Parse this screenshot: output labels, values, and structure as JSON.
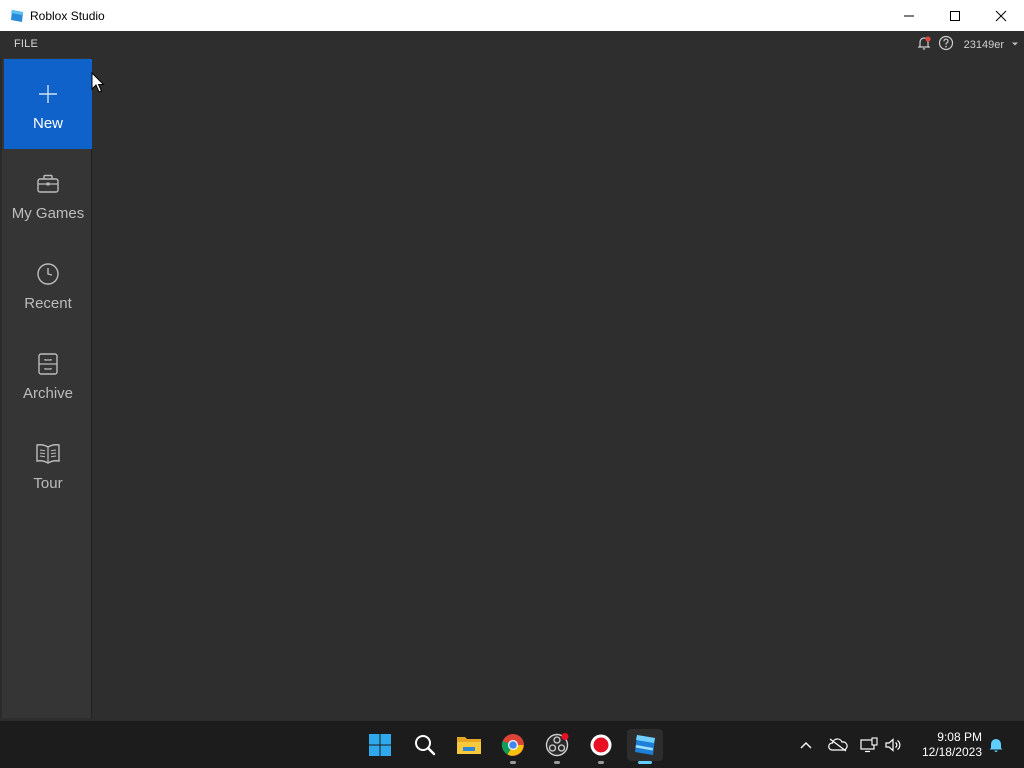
{
  "window": {
    "title": "Roblox Studio",
    "controls": [
      "minimize-icon",
      "maximize-icon",
      "close-icon"
    ]
  },
  "menubar": {
    "file_label": "FILE",
    "username": "23149er",
    "icons": [
      "notification-bell-icon",
      "help-icon",
      "chevron-down-icon"
    ]
  },
  "sidebar": {
    "items": [
      {
        "label": "New",
        "icon": "plus-icon",
        "active": true
      },
      {
        "label": "My Games",
        "icon": "briefcase-icon",
        "active": false
      },
      {
        "label": "Recent",
        "icon": "clock-icon",
        "active": false
      },
      {
        "label": "Archive",
        "icon": "archive-icon",
        "active": false
      },
      {
        "label": "Tour",
        "icon": "book-icon",
        "active": false
      }
    ]
  },
  "taskbar": {
    "apps": [
      "windows-start-icon",
      "search-icon",
      "file-explorer-icon",
      "chrome-icon",
      "obs-icon",
      "record-icon",
      "roblox-studio-icon"
    ],
    "tray": [
      "chevron-up-icon",
      "onedrive-offline-icon",
      "network-icon",
      "volume-icon",
      "notification-icon"
    ],
    "time": "9:08 PM",
    "date": "12/18/2023"
  },
  "colors": {
    "accent": "#0f62c9",
    "background": "#2e2e2e",
    "sidebar": "#353535",
    "taskbar": "#1c1c1c"
  }
}
